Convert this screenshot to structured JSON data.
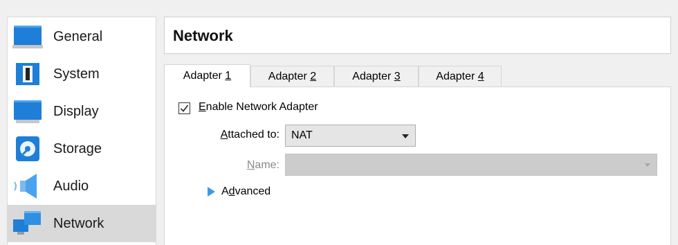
{
  "sidebar": {
    "items": [
      {
        "label": "General",
        "icon": "general-icon"
      },
      {
        "label": "System",
        "icon": "system-icon"
      },
      {
        "label": "Display",
        "icon": "display-icon"
      },
      {
        "label": "Storage",
        "icon": "storage-icon"
      },
      {
        "label": "Audio",
        "icon": "audio-icon"
      },
      {
        "label": "Network",
        "icon": "network-icon",
        "selected": true
      }
    ]
  },
  "header": {
    "title": "Network"
  },
  "tabs": [
    {
      "prefix": "Adapter ",
      "mnemonic": "1",
      "active": true
    },
    {
      "prefix": "Adapter ",
      "mnemonic": "2"
    },
    {
      "prefix": "Adapter ",
      "mnemonic": "3"
    },
    {
      "prefix": "Adapter ",
      "mnemonic": "4"
    }
  ],
  "adapter": {
    "enable_mnemonic": "E",
    "enable_rest": "nable Network Adapter",
    "enabled": true,
    "attached_mnemonic": "A",
    "attached_rest": "ttached to:",
    "attached_value": "NAT",
    "name_mnemonic": "N",
    "name_rest": "ame:",
    "name_value": "",
    "advanced_first": "A",
    "advanced_mnemonic": "d",
    "advanced_rest": "vanced"
  },
  "colors": {
    "selected_bg": "#d9d9d9",
    "icon_blue": "#1e7ed8",
    "advanced_arrow": "#3c9be0"
  }
}
